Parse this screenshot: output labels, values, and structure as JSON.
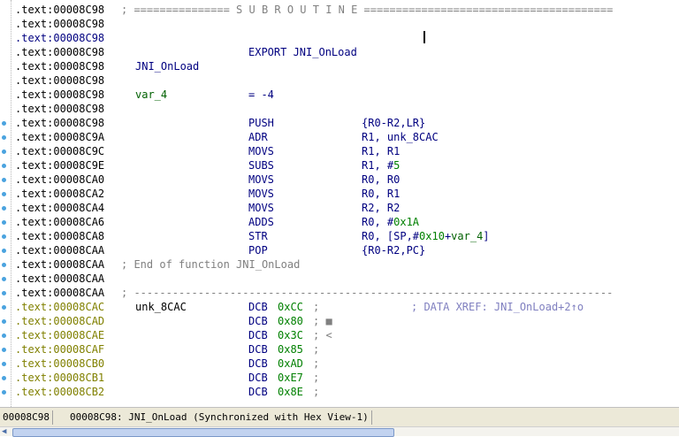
{
  "lines": [
    {
      "addr": ".text:00008C98",
      "comment": "; =============== S U B R O U T I N E ======================================="
    },
    {
      "addr": ".text:00008C98"
    },
    {
      "addr": ".text:00008C98"
    },
    {
      "addr": ".text:00008C98",
      "instr": "EXPORT JNI_OnLoad"
    },
    {
      "addr": ".text:00008C98",
      "name": "JNI_OnLoad"
    },
    {
      "addr": ".text:00008C98"
    },
    {
      "addr": ".text:00008C98",
      "var": "var_4",
      "eq": "= -4"
    },
    {
      "addr": ".text:00008C98"
    },
    {
      "addr": ".text:00008C98",
      "instr": "PUSH",
      "ops": "{R0-R2,LR}"
    },
    {
      "addr": ".text:00008C9A",
      "instr": "ADR",
      "ops": "R1, unk_8CAC"
    },
    {
      "addr": ".text:00008C9C",
      "instr": "MOVS",
      "ops": "R1, R1"
    },
    {
      "addr": ".text:00008C9E",
      "instr": "SUBS",
      "ops_pre": "R1, #",
      "ops_num": "5"
    },
    {
      "addr": ".text:00008CA0",
      "instr": "MOVS",
      "ops": "R0, R0"
    },
    {
      "addr": ".text:00008CA2",
      "instr": "MOVS",
      "ops": "R0, R1"
    },
    {
      "addr": ".text:00008CA4",
      "instr": "MOVS",
      "ops": "R2, R2"
    },
    {
      "addr": ".text:00008CA6",
      "instr": "ADDS",
      "ops_pre": "R0, #",
      "ops_num": "0x1A"
    },
    {
      "addr": ".text:00008CA8",
      "instr": "STR",
      "ops_pre": "R0, [SP,#",
      "ops_num": "0x10",
      "ops_mid": "+",
      "ops_var": "var_4",
      "ops_post": "]"
    },
    {
      "addr": ".text:00008CAA",
      "instr": "POP",
      "ops": "{R0-R2,PC}"
    },
    {
      "addr": ".text:00008CAA",
      "comment": "; End of function JNI_OnLoad"
    },
    {
      "addr": ".text:00008CAA"
    },
    {
      "addr": ".text:00008CAA",
      "comment": "; ---------------------------------------------------------------------------"
    },
    {
      "addr": ".text:00008CAC",
      "dname": "unk_8CAC",
      "instr": "DCB",
      "dnum": "0xCC",
      "dcom": ";",
      "xref": "; DATA XREF: JNI_OnLoad+2↑o"
    },
    {
      "addr": ".text:00008CAD",
      "instr": "DCB",
      "dnum": "0x80",
      "dcom": "; ■"
    },
    {
      "addr": ".text:00008CAE",
      "instr": "DCB",
      "dnum": "0x3C",
      "dcom": "; <"
    },
    {
      "addr": ".text:00008CAF",
      "instr": "DCB",
      "dnum": "0x85",
      "dcom": ";"
    },
    {
      "addr": ".text:00008CB0",
      "instr": "DCB",
      "dnum": "0xAD",
      "dcom": ";"
    },
    {
      "addr": ".text:00008CB1",
      "instr": "DCB",
      "dnum": "0xE7",
      "dcom": ";"
    },
    {
      "addr": ".text:00008CB2",
      "instr": "DCB",
      "dnum": "0x8E",
      "dcom": ";"
    }
  ],
  "status": {
    "offset": "00008C98",
    "location": "00008C98: JNI_OnLoad (Synchronized with Hex View-1)"
  }
}
